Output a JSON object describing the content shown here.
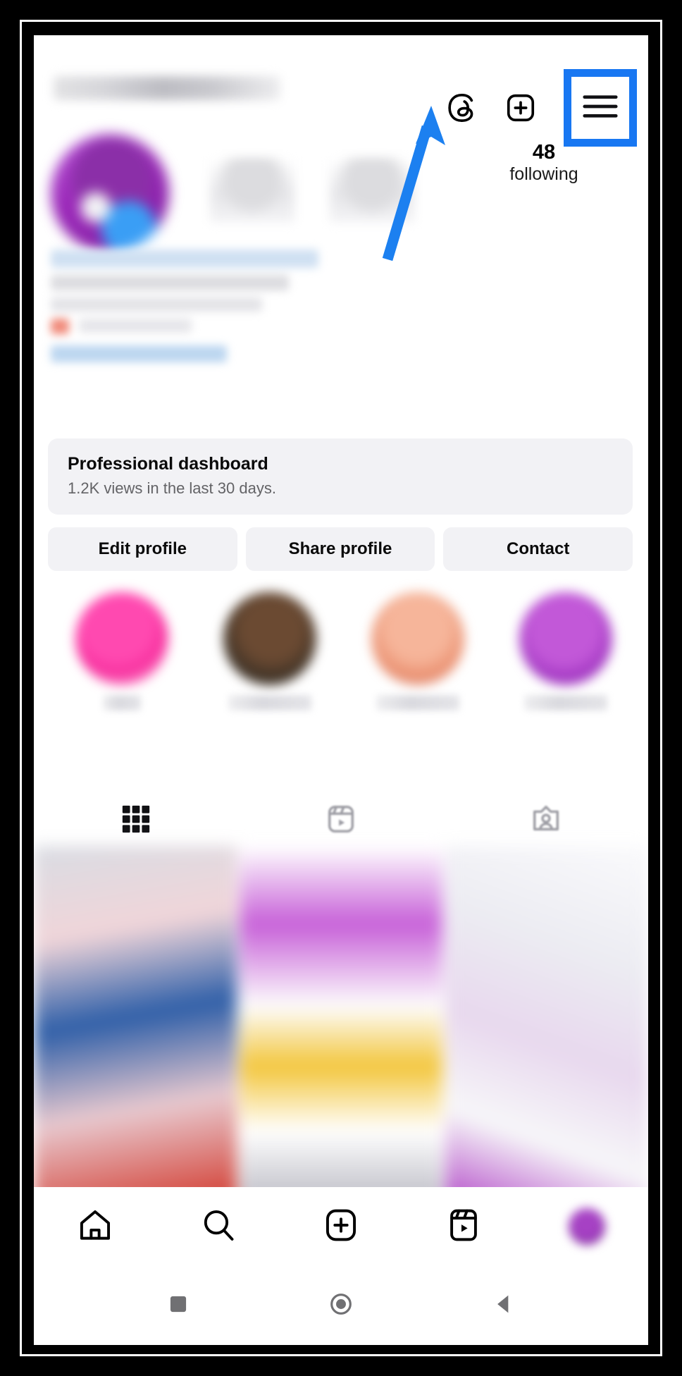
{
  "annotation": {
    "highlight_color": "#1877f2",
    "arrow_color": "#1877f2",
    "target_icon": "hamburger-menu-icon"
  },
  "header": {
    "threads_icon": "threads-icon",
    "create_icon": "plus-square-icon",
    "menu_icon": "hamburger-menu-icon",
    "username_redacted": ""
  },
  "profile": {
    "avatar": "profile-avatar",
    "stats": [
      {
        "key": "posts",
        "value": "",
        "label": ""
      },
      {
        "key": "followers",
        "value": "",
        "label": ""
      },
      {
        "key": "following",
        "value": "48",
        "label": "following"
      }
    ]
  },
  "dashboard": {
    "title": "Professional dashboard",
    "subtitle": "1.2K views in the last 30 days."
  },
  "actions": [
    {
      "id": "edit-profile",
      "label": "Edit profile"
    },
    {
      "id": "share-profile",
      "label": "Share profile"
    },
    {
      "id": "contact",
      "label": "Contact"
    }
  ],
  "highlights": [
    {
      "id": "highlight-1",
      "label": ""
    },
    {
      "id": "highlight-2",
      "label": ""
    },
    {
      "id": "highlight-3",
      "label": ""
    },
    {
      "id": "highlight-4",
      "label": ""
    }
  ],
  "content_tabs": [
    {
      "id": "tab-grid",
      "icon": "grid-icon",
      "active": true
    },
    {
      "id": "tab-reels",
      "icon": "reels-icon",
      "active": false
    },
    {
      "id": "tab-tagged",
      "icon": "tagged-person-icon",
      "active": false
    }
  ],
  "bottom_nav": [
    {
      "id": "nav-home",
      "icon": "home-icon"
    },
    {
      "id": "nav-search",
      "icon": "search-icon"
    },
    {
      "id": "nav-create",
      "icon": "plus-square-icon"
    },
    {
      "id": "nav-reels",
      "icon": "reels-icon"
    },
    {
      "id": "nav-profile",
      "icon": "profile-avatar-icon"
    }
  ],
  "system_nav": [
    {
      "id": "sys-recents",
      "icon": "square-icon"
    },
    {
      "id": "sys-home",
      "icon": "circle-icon"
    },
    {
      "id": "sys-back",
      "icon": "triangle-back-icon"
    }
  ]
}
